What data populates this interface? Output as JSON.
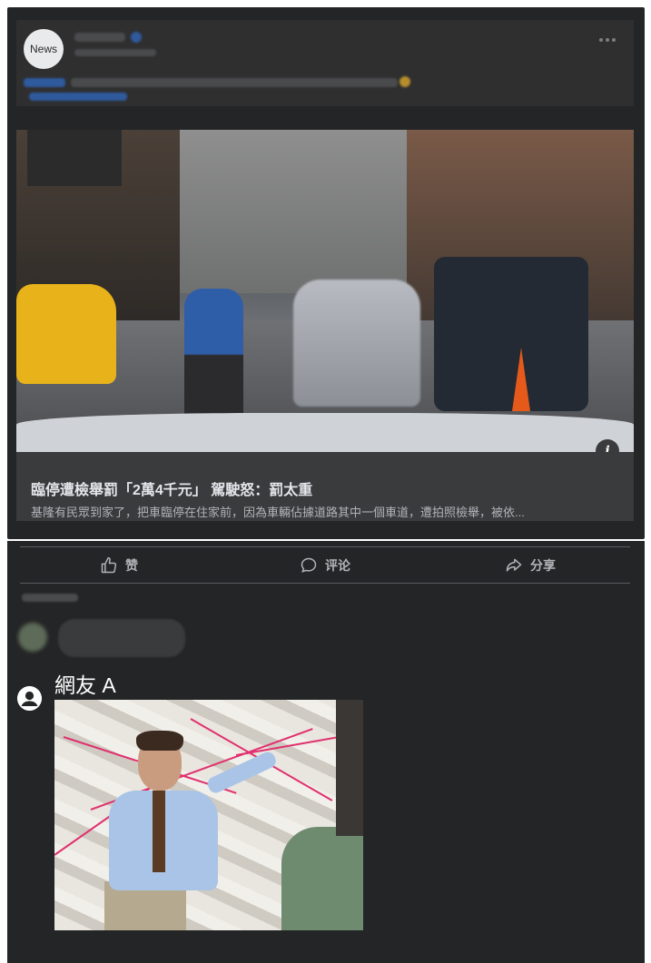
{
  "post": {
    "page_avatar_text": "News",
    "link_preview": {
      "title": "臨停遭檢舉罰「2萬4千元」 駕駛怒：罰太重",
      "description": "基隆有民眾到家了，把車臨停在住家前，因為車輛佔據道路其中一個車道，遭拍照檢舉，被依...",
      "info_icon": "i"
    }
  },
  "actions": {
    "like_label": "赞",
    "comment_label": "评论",
    "share_label": "分享"
  },
  "reply": {
    "user_name": "網友 A"
  },
  "colors": {
    "card_bg": "#242526",
    "link_box_bg": "#3a3b3c",
    "text_primary": "#e4e6eb",
    "text_secondary": "#b0b3b8"
  }
}
